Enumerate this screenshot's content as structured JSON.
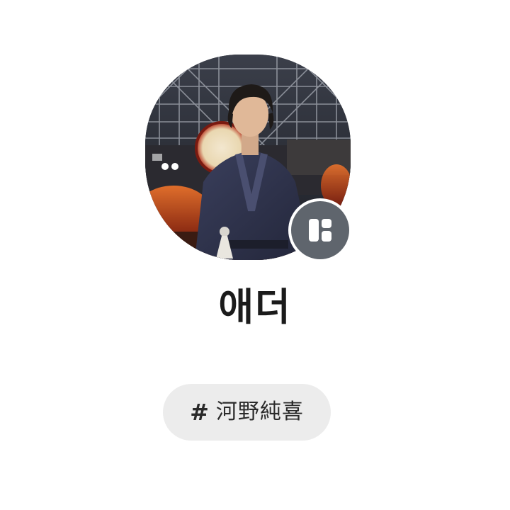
{
  "profile": {
    "name": "애더",
    "photo_icon": "profile-photo",
    "badge_icon": "layout-icon"
  },
  "tag": {
    "hash": "#",
    "label": "河野純喜"
  },
  "colors": {
    "background": "#ffffff",
    "badge": "#5f656d",
    "chip_background": "#ececec",
    "text": "#1b1b1b"
  }
}
